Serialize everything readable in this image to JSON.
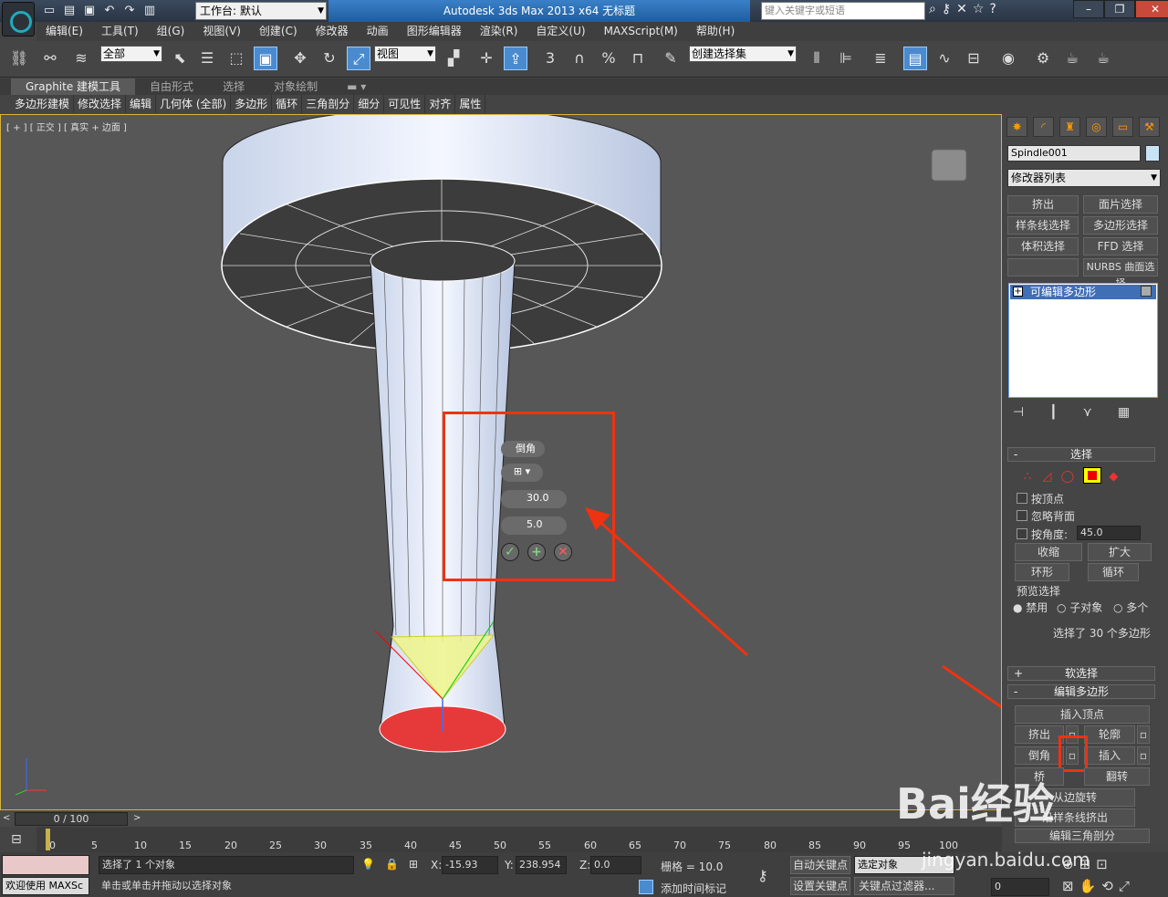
{
  "title": {
    "workspace": "工作台: 默认",
    "app_title": "Autodesk 3ds Max  2013 x64      无标题",
    "search_placeholder": "键入关键字或短语"
  },
  "menu": [
    "编辑(E)",
    "工具(T)",
    "组(G)",
    "视图(V)",
    "创建(C)",
    "修改器",
    "动画",
    "图形编辑器",
    "渲染(R)",
    "自定义(U)",
    "MAXScript(M)",
    "帮助(H)"
  ],
  "toolbar": {
    "selection_filter": "全部",
    "ref_coord": "视图",
    "named_sel": "创建选择集",
    "snap3": "3",
    "percent": "%"
  },
  "ribbon": {
    "tabs": [
      "Graphite 建模工具",
      "自由形式",
      "选择",
      "对象绘制"
    ],
    "panels": [
      "多边形建模",
      "修改选择",
      "编辑",
      "几何体 (全部)",
      "多边形",
      "循环",
      "三角剖分",
      "细分",
      "可见性",
      "对齐",
      "属性"
    ]
  },
  "viewport": {
    "label": "[ + ] [ 正交 ] [ 真实 + 边面 ]"
  },
  "caddy": {
    "title": "倒角",
    "height": "30.0",
    "outline": "5.0"
  },
  "command_panel": {
    "object_name": "Spindle001",
    "object_color": "#c9e3f6",
    "modifier_list": "修改器列表",
    "mod_buttons": [
      "挤出",
      "面片选择",
      "样条线选择",
      "多边形选择",
      "体积选择",
      "FFD 选择",
      "",
      "NURBS 曲面选择"
    ],
    "stack_item": "可编辑多边形",
    "selection": {
      "title": "选择",
      "by_vertex": "按顶点",
      "ignore_backface": "忽略背面",
      "by_angle": "按角度:",
      "angle_value": "45.0",
      "shrink": "收缩",
      "grow": "扩大",
      "ring": "环形",
      "loop": "循环",
      "preview": "预览选择",
      "disabled": "禁用",
      "subobject": "子对象",
      "multi": "多个",
      "status": "选择了 30 个多边形"
    },
    "soft_selection": "软选择",
    "edit_poly": {
      "title": "编辑多边形",
      "insert_vertex": "插入顶点",
      "extrude": "挤出",
      "outline": "轮廓",
      "bevel": "倒角",
      "inset": "插入",
      "bridge": "桥",
      "flip": "翻转",
      "hinge": "从边旋转",
      "extrude_spline": "沿样条线挤出",
      "edit_tri": "编辑三角剖分"
    }
  },
  "timeline": {
    "slider": "0 / 100",
    "ticks": [
      "0",
      "5",
      "10",
      "15",
      "20",
      "25",
      "30",
      "35",
      "40",
      "45",
      "50",
      "55",
      "60",
      "65",
      "70",
      "75",
      "80",
      "85",
      "90",
      "95",
      "100"
    ]
  },
  "status": {
    "welcome": "欢迎使用 MAXSc",
    "selected": "选择了 1 个对象",
    "hint": "单击或单击并拖动以选择对象",
    "x_label": "X:",
    "x": "-15.93",
    "y_label": "Y:",
    "y": "238.954",
    "z_label": "Z:",
    "z": "0.0",
    "grid": "栅格 = 10.0",
    "auto_key": "自动关键点",
    "set_key": "设置关键点",
    "key_mode": "选定对象",
    "key_filters": "关键点过滤器...",
    "add_time_tag": "添加时间标记",
    "frame": "0"
  },
  "watermark": {
    "brand": "Bai经验",
    "url": "jingyan.baidu.com"
  }
}
